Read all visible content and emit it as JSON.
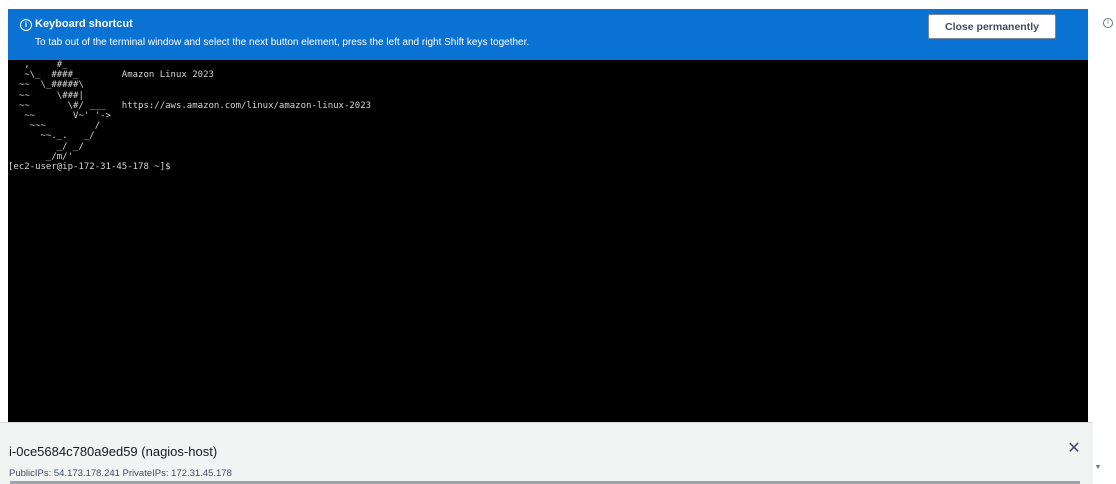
{
  "banner": {
    "icon": "info-circle-icon",
    "icon_glyph": "i",
    "title": "Keyboard shortcut",
    "message": "To tab out of the terminal window and select the next button element, press the left and right Shift keys together.",
    "button_label": "Close permanently",
    "background_color": "#0972d3"
  },
  "terminal": {
    "output": "   ,     #_\n   ~\\_  ####_        Amazon Linux 2023\n  ~~  \\_#####\\\n  ~~     \\###|\n  ~~       \\#/ ___   https://aws.amazon.com/linux/amazon-linux-2023\n   ~~       V~' '->\n    ~~~         /\n      ~~._.   _/\n         _/ _/\n       _/m/'\n[ec2-user@ip-172-31-45-178 ~]$",
    "background_color": "#000000"
  },
  "instance": {
    "title": "i-0ce5684c780a9ed59 (nagios-host)",
    "ips": "PublicIPs: 54.173.178.241   PrivateIPs: 172.31.45.178",
    "close_icon": "close-icon",
    "close_glyph": "✕"
  },
  "gutter": {
    "top_icon_glyph": "i",
    "scroll_down_glyph": "▼"
  }
}
